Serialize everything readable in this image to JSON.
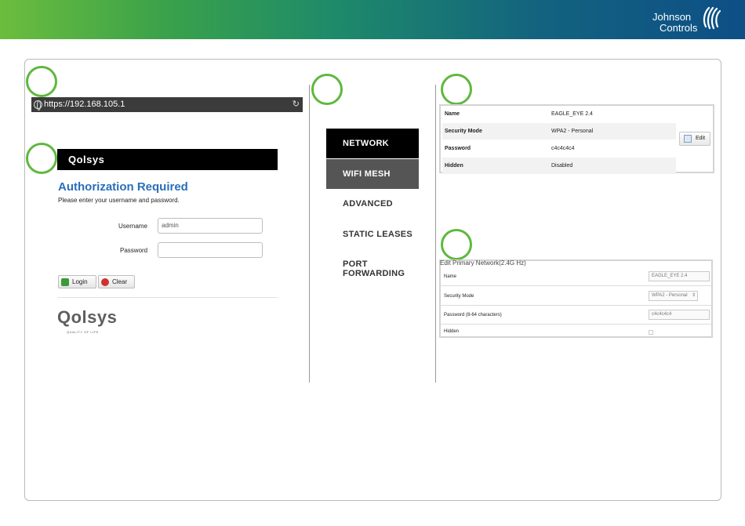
{
  "brand": {
    "line1": "Johnson",
    "line2": "Controls"
  },
  "browser": {
    "url": "https://192.168.105.1"
  },
  "login": {
    "header_logo": "Qolsys",
    "title": "Authorization Required",
    "subtitle": "Please enter your username and password.",
    "username_label": "Username",
    "username_value": "admin",
    "password_label": "Password",
    "password_value": "",
    "login_button": "Login",
    "clear_button": "Clear",
    "footer_logo": "Qolsys",
    "footer_tagline": "QUALITY OF LIFE"
  },
  "nav": {
    "items": [
      {
        "label": "NETWORK"
      },
      {
        "label": "WIFI MESH"
      },
      {
        "label": "ADVANCED"
      },
      {
        "label": "STATIC LEASES"
      },
      {
        "label": "PORT",
        "label2": "FORWARDING"
      }
    ]
  },
  "network_info": {
    "rows": [
      {
        "key": "Name",
        "value": "EAGLE_EYE 2.4"
      },
      {
        "key": "Security Mode",
        "value": "WPA2 - Personal"
      },
      {
        "key": "Password",
        "value": "c4c4c4c4"
      },
      {
        "key": "Hidden",
        "value": "Disabled"
      }
    ],
    "edit_button": "Edit"
  },
  "edit_form": {
    "title": "Edit Primary Network(2.4G Hz)",
    "name_label": "Name",
    "name_value": "EAGLE_EYE 2.4",
    "security_label": "Security Mode",
    "security_value": "WPA2 - Personal",
    "password_label": "Password (8-64 characters)",
    "password_value": "c4c4c4c4",
    "hidden_label": "Hidden",
    "hidden_checked": false
  },
  "colors": {
    "accent_green": "#5fb83e",
    "link_blue": "#2a6fb8",
    "nav_active": "#000000",
    "nav_selected": "#555555"
  }
}
